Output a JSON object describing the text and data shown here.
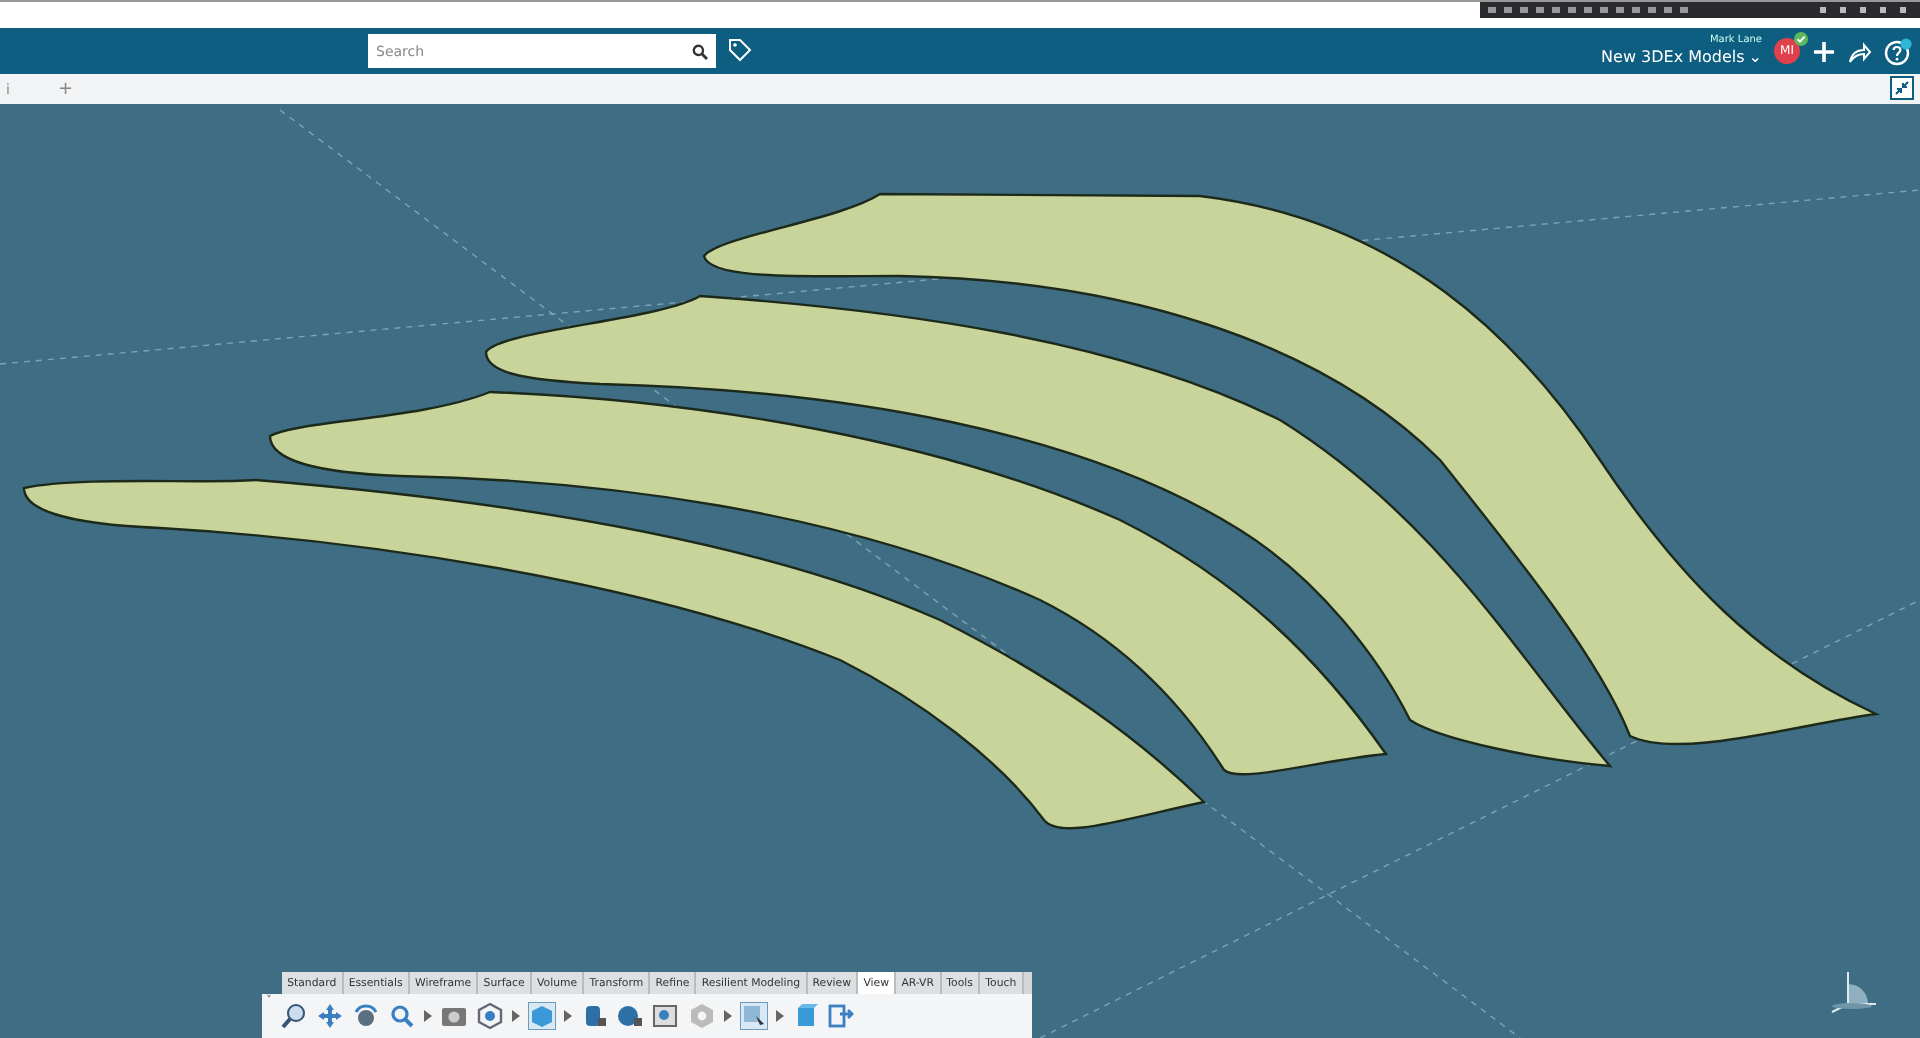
{
  "header": {
    "search": {
      "placeholder": "Search"
    },
    "user_name": "Mark Lane",
    "collection": "New 3DEx Models",
    "collection_caret": "⌄",
    "avatar_initials": "MI",
    "avatar_verified": true
  },
  "tab_strip": {
    "tab_fragment": "i",
    "add_tab": "+"
  },
  "toolbar": {
    "collapse": "˅",
    "tabs": [
      {
        "label": "Standard",
        "selected": false
      },
      {
        "label": "Essentials",
        "selected": false
      },
      {
        "label": "Wireframe",
        "selected": false
      },
      {
        "label": "Surface",
        "selected": false
      },
      {
        "label": "Volume",
        "selected": false
      },
      {
        "label": "Transform",
        "selected": false
      },
      {
        "label": "Refine",
        "selected": false
      },
      {
        "label": "Resilient Modeling",
        "selected": false
      },
      {
        "label": "Review",
        "selected": false
      },
      {
        "label": "View",
        "selected": true
      },
      {
        "label": "AR-VR",
        "selected": false
      },
      {
        "label": "Tools",
        "selected": false
      },
      {
        "label": "Touch",
        "selected": false
      }
    ]
  }
}
